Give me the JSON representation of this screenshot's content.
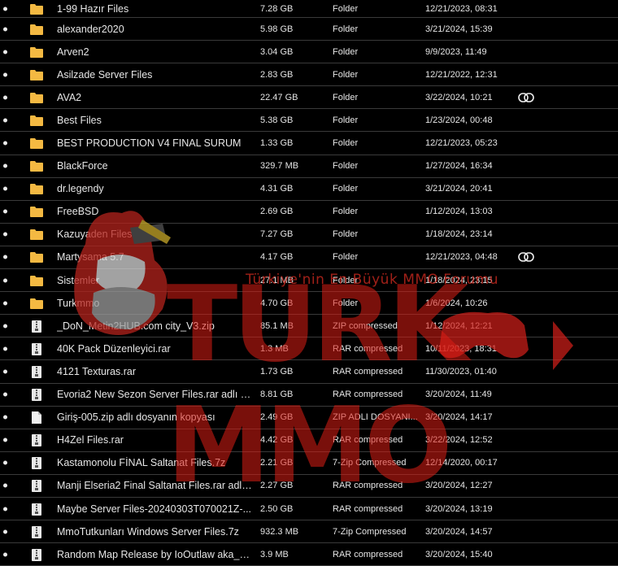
{
  "colors": {
    "background": "#000000",
    "text": "#e6e6e6",
    "folder": "#f4b942",
    "divider": "#3a3a3a",
    "watermark": "#dc1e14"
  },
  "watermark": {
    "brand": "TURK MMO",
    "tagline": "Türkiye'nin En Büyük MMO Forumu"
  },
  "files": [
    {
      "name": "1-99 Hazır Files",
      "size": "7.28 GB",
      "type": "Folder",
      "date": "12/21/2023, 08:31",
      "icon": "folder-icon",
      "shared": false
    },
    {
      "name": "alexander2020",
      "size": "5.98 GB",
      "type": "Folder",
      "date": "3/21/2024, 15:39",
      "icon": "folder-icon",
      "shared": false
    },
    {
      "name": "Arven2",
      "size": "3.04 GB",
      "type": "Folder",
      "date": "9/9/2023, 11:49",
      "icon": "folder-icon",
      "shared": false
    },
    {
      "name": "Asilzade Server Files",
      "size": "2.83 GB",
      "type": "Folder",
      "date": "12/21/2022, 12:31",
      "icon": "folder-icon",
      "shared": false
    },
    {
      "name": "AVA2",
      "size": "22.47 GB",
      "type": "Folder",
      "date": "3/22/2024, 10:21",
      "icon": "folder-icon",
      "shared": true
    },
    {
      "name": "Best Files",
      "size": "5.38 GB",
      "type": "Folder",
      "date": "1/23/2024, 00:48",
      "icon": "folder-icon",
      "shared": false
    },
    {
      "name": "BEST PRODUCTION V4 FINAL SURUM",
      "size": "1.33 GB",
      "type": "Folder",
      "date": "12/21/2023, 05:23",
      "icon": "folder-icon",
      "shared": false
    },
    {
      "name": "BlackForce",
      "size": "329.7 MB",
      "type": "Folder",
      "date": "1/27/2024, 16:34",
      "icon": "folder-icon",
      "shared": false
    },
    {
      "name": "dr.legendy",
      "size": "4.31 GB",
      "type": "Folder",
      "date": "3/21/2024, 20:41",
      "icon": "folder-icon",
      "shared": false
    },
    {
      "name": "FreeBSD",
      "size": "2.69 GB",
      "type": "Folder",
      "date": "1/12/2024, 13:03",
      "icon": "folder-icon",
      "shared": false
    },
    {
      "name": "Kazuyaden Files",
      "size": "7.27 GB",
      "type": "Folder",
      "date": "1/18/2024, 23:14",
      "icon": "folder-icon",
      "shared": false
    },
    {
      "name": "Martysama 5.7",
      "size": "4.17 GB",
      "type": "Folder",
      "date": "12/21/2023, 04:48",
      "icon": "folder-icon",
      "shared": true
    },
    {
      "name": "Sistemler",
      "size": "27.1 MB",
      "type": "Folder",
      "date": "1/18/2024, 23:15",
      "icon": "folder-icon",
      "shared": false
    },
    {
      "name": "Turkmmo",
      "size": "4.70 GB",
      "type": "Folder",
      "date": "1/6/2024, 10:26",
      "icon": "folder-icon",
      "shared": false
    },
    {
      "name": "_DoN_Metin2HUB.com city_V3.zip",
      "size": "85.1 MB",
      "type": "ZIP compressed",
      "date": "1/12/2024, 12:21",
      "icon": "archive-icon",
      "shared": false
    },
    {
      "name": "40K Pack Düzenleyici.rar",
      "size": "1.3 MB",
      "type": "RAR compressed",
      "date": "10/11/2023, 18:31",
      "icon": "archive-icon",
      "shared": false
    },
    {
      "name": "4121 Texturas.rar",
      "size": "1.73 GB",
      "type": "RAR compressed",
      "date": "11/30/2023, 01:40",
      "icon": "archive-icon",
      "shared": false
    },
    {
      "name": "Evoria2 New Sezon Server Files.rar adlı d...",
      "size": "8.81 GB",
      "type": "RAR compressed",
      "date": "3/20/2024, 11:49",
      "icon": "archive-icon",
      "shared": false
    },
    {
      "name": "Giriş-005.zip adlı dosyanın kopyası",
      "size": "2.49 GB",
      "type": "ZIP ADLI DOSYANI...",
      "date": "3/20/2024, 14:17",
      "icon": "document-icon",
      "shared": false
    },
    {
      "name": "H4Zel Files.rar",
      "size": "4.42 GB",
      "type": "RAR compressed",
      "date": "3/22/2024, 12:52",
      "icon": "archive-icon",
      "shared": false
    },
    {
      "name": "Kastamonolu FİNAL Saltanat Files.7z",
      "size": "2.21 GB",
      "type": "7-Zip Compressed",
      "date": "12/14/2020, 00:17",
      "icon": "archive-icon",
      "shared": false
    },
    {
      "name": "Manji Elseria2 Final Saltanat Files.rar adlı ...",
      "size": "2.27 GB",
      "type": "RAR compressed",
      "date": "3/20/2024, 12:27",
      "icon": "archive-icon",
      "shared": false
    },
    {
      "name": "Maybe Server Files-20240303T070021Z-...",
      "size": "2.50 GB",
      "type": "RAR compressed",
      "date": "3/20/2024, 13:19",
      "icon": "archive-icon",
      "shared": false
    },
    {
      "name": "MmoTutkunları Windows Server Files.7z",
      "size": "932.3 MB",
      "type": "7-Zip Compressed",
      "date": "3/20/2024, 14:57",
      "icon": "archive-icon",
      "shared": false
    },
    {
      "name": "Random Map Release by IoOutlaw aka_Te...",
      "size": "3.9 MB",
      "type": "RAR compressed",
      "date": "3/20/2024, 15:40",
      "icon": "archive-icon",
      "shared": false
    }
  ]
}
